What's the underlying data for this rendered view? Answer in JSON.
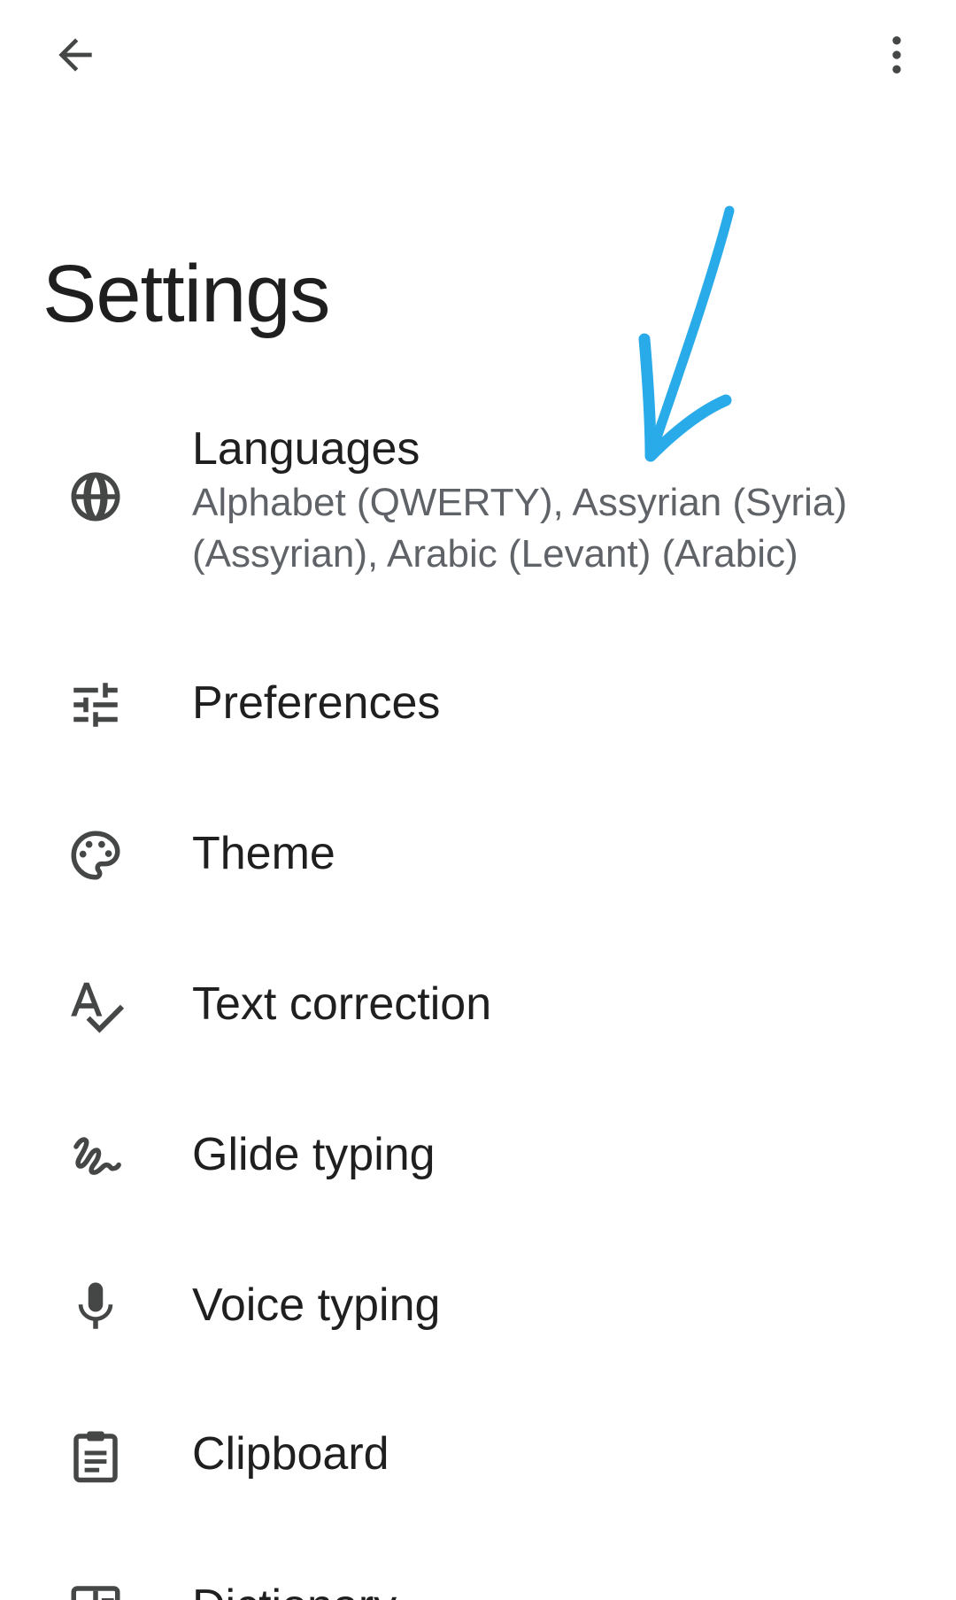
{
  "header": {
    "title": "Settings"
  },
  "settings": {
    "items": [
      {
        "label": "Languages",
        "summary": "Alphabet (QWERTY), Assyrian (Syria) (Assyrian), Arabic (Levant) (Arabic)",
        "icon": "globe-icon"
      },
      {
        "label": "Preferences",
        "icon": "tune-icon"
      },
      {
        "label": "Theme",
        "icon": "palette-icon"
      },
      {
        "label": "Text correction",
        "icon": "spellcheck-icon"
      },
      {
        "label": "Glide typing",
        "icon": "gesture-icon"
      },
      {
        "label": "Voice typing",
        "icon": "microphone-icon"
      },
      {
        "label": "Clipboard",
        "icon": "clipboard-icon"
      },
      {
        "label": "Dictionary",
        "icon": "dictionary-icon"
      }
    ]
  },
  "colors": {
    "background": "#ffffff",
    "text_primary": "#1f1f1f",
    "text_secondary": "#5f6368",
    "icon": "#444746",
    "annotation_arrow": "#29abe9"
  }
}
